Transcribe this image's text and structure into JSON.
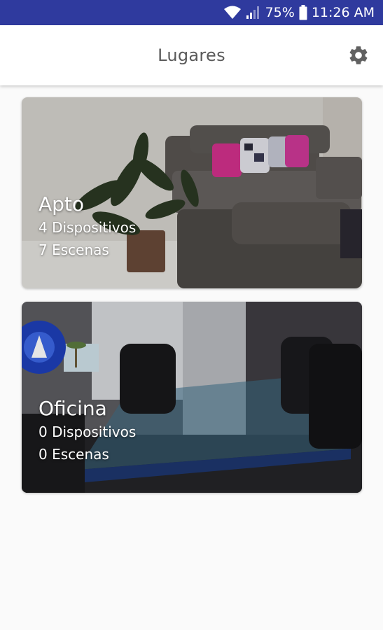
{
  "status_bar": {
    "battery_percent": "75%",
    "time": "11:26 AM",
    "icons": [
      "wifi-icon",
      "signal-icon",
      "battery-icon"
    ]
  },
  "app_bar": {
    "title": "Lugares",
    "settings_icon": "gear-icon"
  },
  "places": [
    {
      "name": "Apto",
      "devices": "4 Dispositivos",
      "scenes": "7 Escenas"
    },
    {
      "name": "Oficina",
      "devices": "0 Dispositivos",
      "scenes": "0 Escenas"
    }
  ],
  "colors": {
    "status_bar": "#2f3a9e",
    "app_bar": "#ffffff",
    "background": "#fafafa",
    "title_text": "#5a5a5a",
    "icon": "#616161"
  }
}
